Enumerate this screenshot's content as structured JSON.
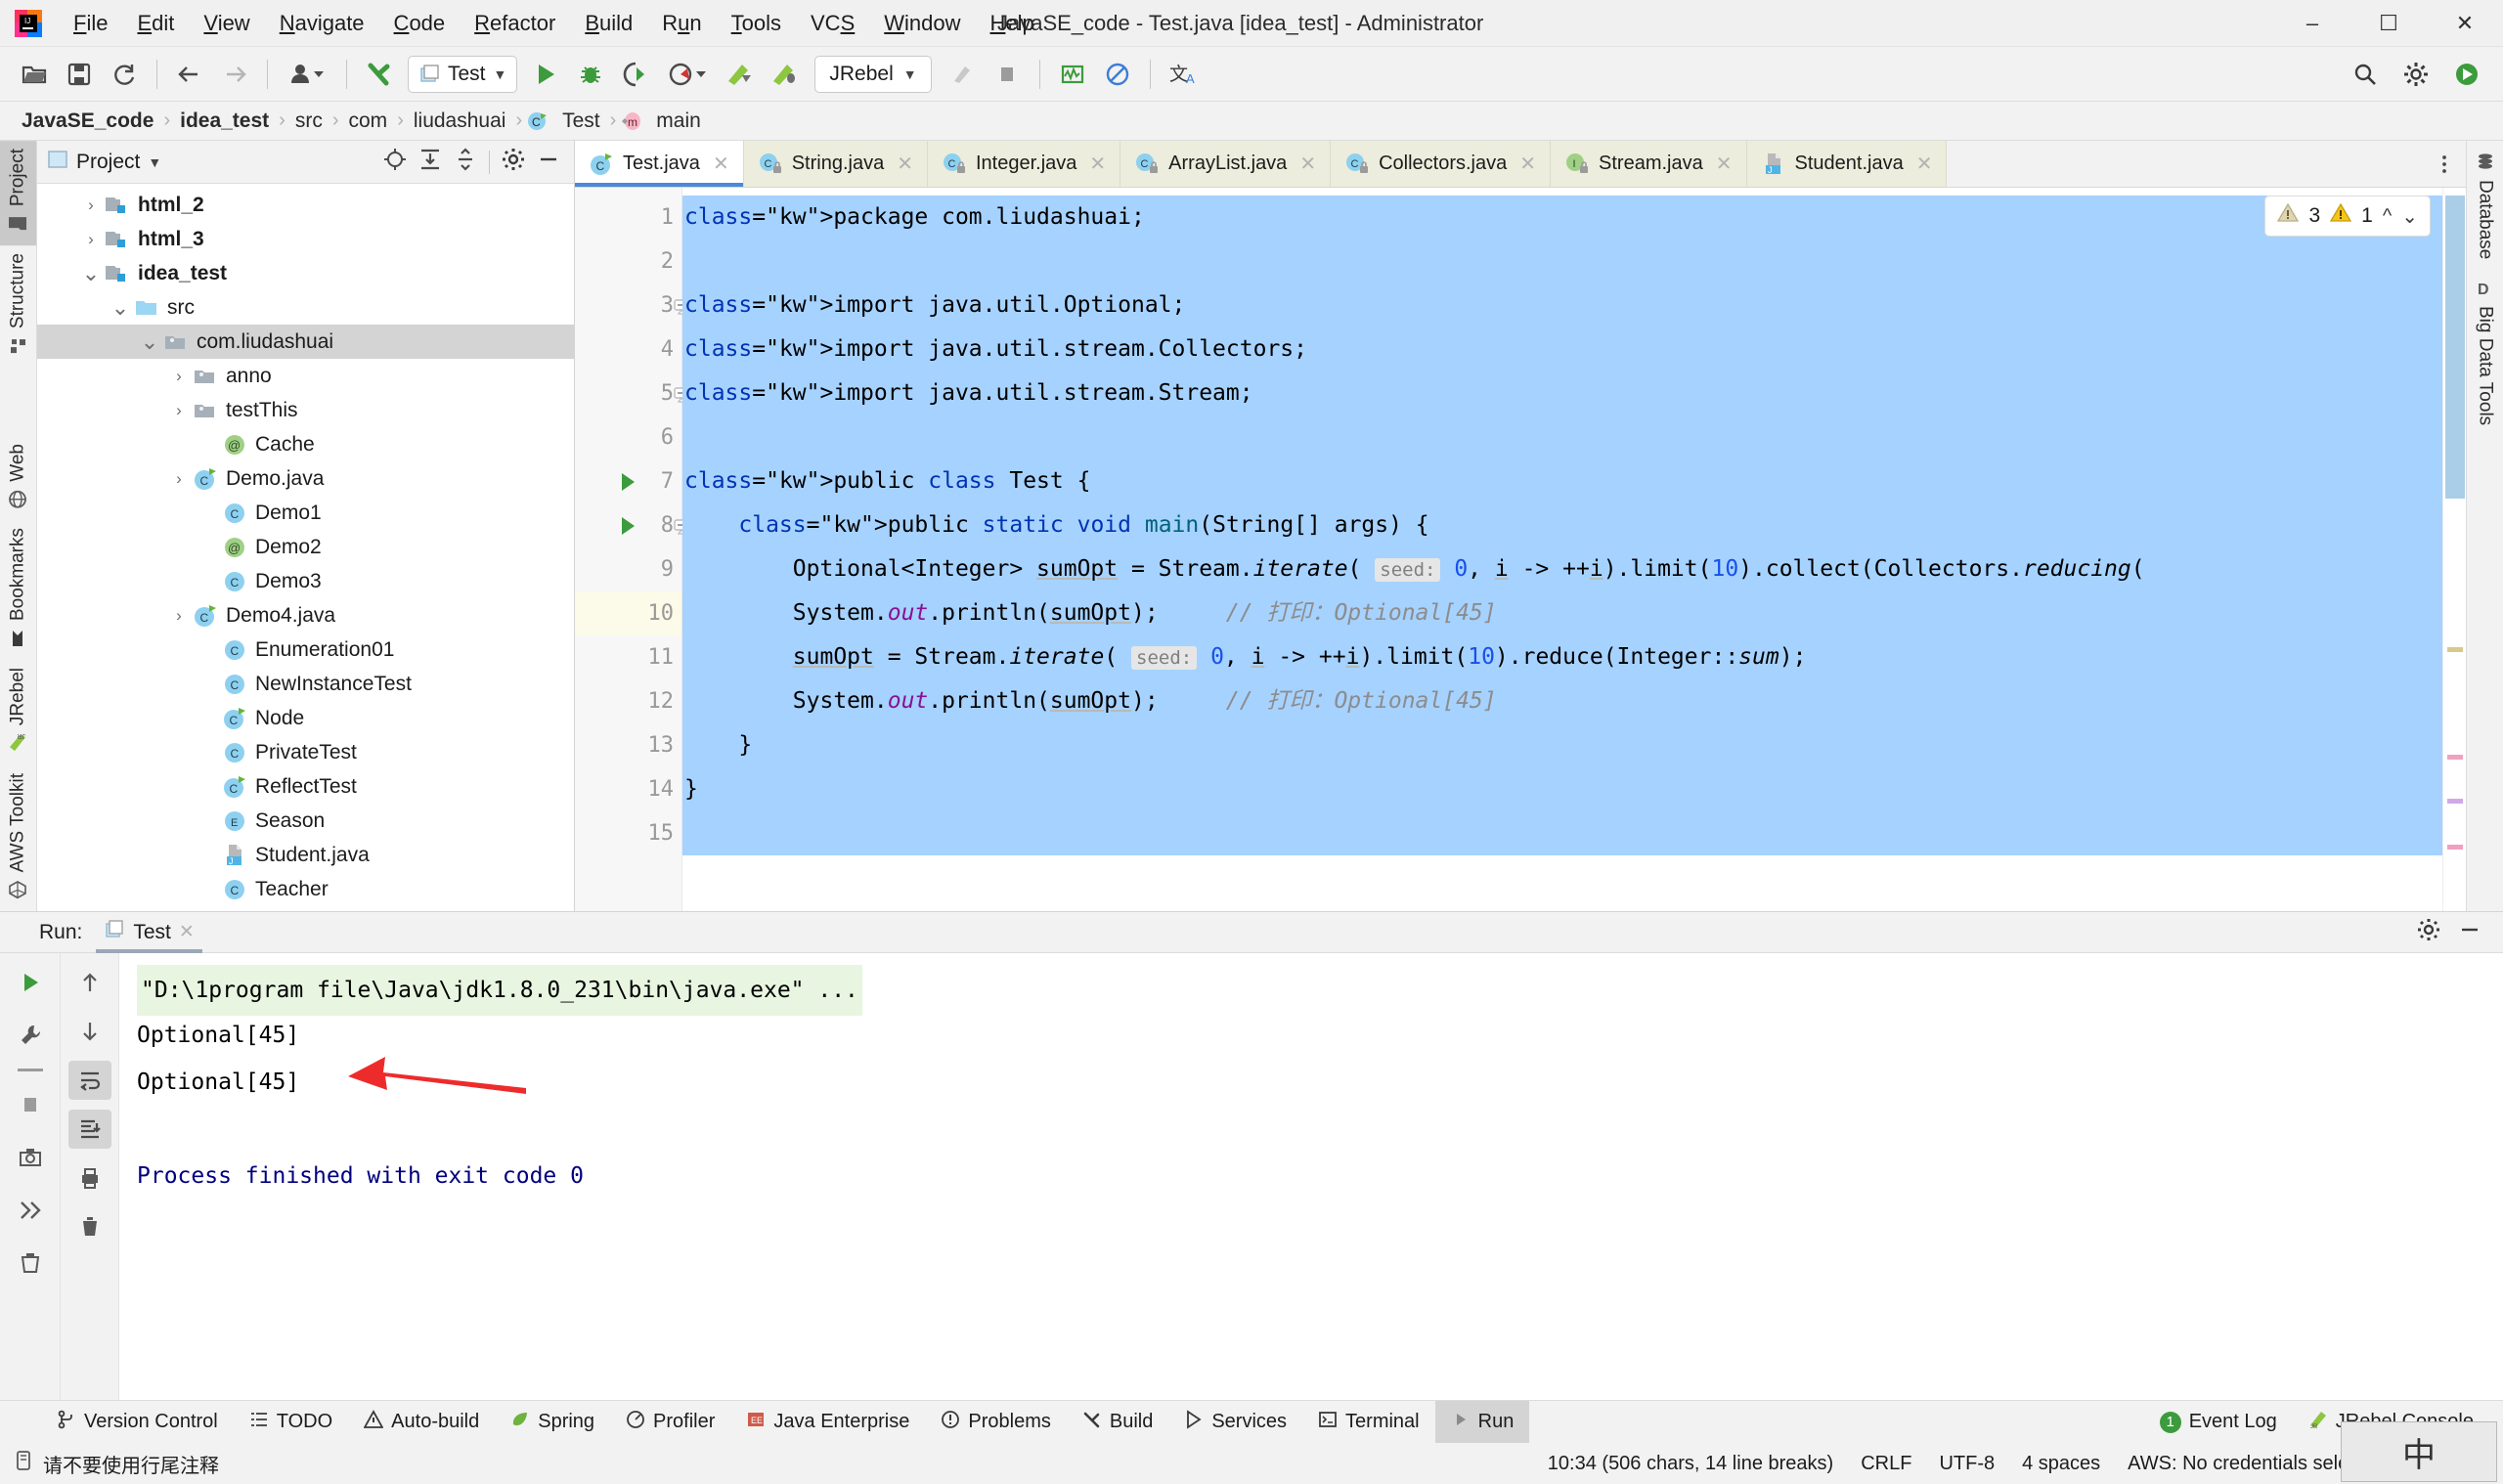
{
  "window": {
    "title": "JavaSE_code - Test.java [idea_test] - Administrator",
    "minimize": "–",
    "maximize": "❐",
    "close": "✕"
  },
  "menubar": {
    "items": [
      {
        "label": "File",
        "mnemonic": "F"
      },
      {
        "label": "Edit",
        "mnemonic": "E"
      },
      {
        "label": "View",
        "mnemonic": "V"
      },
      {
        "label": "Navigate",
        "mnemonic": "N"
      },
      {
        "label": "Code",
        "mnemonic": "C"
      },
      {
        "label": "Refactor",
        "mnemonic": "R"
      },
      {
        "label": "Build",
        "mnemonic": "B"
      },
      {
        "label": "Run",
        "mnemonic": "u"
      },
      {
        "label": "Tools",
        "mnemonic": "T"
      },
      {
        "label": "VCS",
        "mnemonic": "S"
      },
      {
        "label": "Window",
        "mnemonic": "W"
      },
      {
        "label": "Help",
        "mnemonic": "H"
      }
    ]
  },
  "toolbar": {
    "open_label": "Open",
    "save_label": "Save All",
    "sync_label": "Sync",
    "back_label": "Back",
    "forward_label": "Forward",
    "profile_label": "Profile",
    "update_label": "Update Project",
    "run_config": "Test",
    "run_label": "Run",
    "debug_label": "Debug",
    "run_coverage_label": "Run with Coverage",
    "profiler_label": "Profile",
    "jrebel_run_label": "Run with JRebel",
    "jrebel_debug_label": "Debug with JRebel",
    "jrebel_config": "JRebel",
    "stop_label": "Stop",
    "search_label": "Search Everywhere",
    "settings_label": "Settings",
    "translate_label": "Translate"
  },
  "breadcrumbs": {
    "items": [
      {
        "label": "JavaSE_code",
        "bold": true,
        "icon": ""
      },
      {
        "label": "idea_test",
        "bold": true,
        "icon": ""
      },
      {
        "label": "src",
        "bold": false,
        "icon": ""
      },
      {
        "label": "com",
        "bold": false,
        "icon": ""
      },
      {
        "label": "liudashuai",
        "bold": false,
        "icon": ""
      },
      {
        "label": "Test",
        "bold": false,
        "icon": "class-icon"
      },
      {
        "label": "main",
        "bold": false,
        "icon": "method-icon"
      }
    ],
    "separator": "›"
  },
  "left_strip": {
    "tabs": [
      {
        "label": "Project",
        "icon": "folder-icon",
        "active": true
      },
      {
        "label": "Structure",
        "icon": "structure-icon",
        "active": false
      }
    ],
    "bottom_tabs": [
      {
        "label": "Web",
        "icon": "globe-icon"
      },
      {
        "label": "Bookmarks",
        "icon": "bookmark-icon"
      },
      {
        "label": "JRebel",
        "icon": "jrebel-icon"
      },
      {
        "label": "AWS Toolkit",
        "icon": "aws-icon"
      }
    ]
  },
  "right_strip": {
    "tabs": [
      {
        "label": "Database",
        "icon": "database-icon"
      },
      {
        "label": "Big Data Tools",
        "icon": "bigdata-icon"
      }
    ]
  },
  "project_panel": {
    "title": "Project",
    "dropdown": "▼",
    "icons": [
      "locate-icon",
      "expand-all-icon",
      "collapse-all-icon",
      "gear-icon",
      "minimize-icon"
    ],
    "tree": [
      {
        "label": "html_2",
        "indent": 1,
        "twisty": "›",
        "icon": "module-folder-icon",
        "bold": true,
        "selected": false
      },
      {
        "label": "html_3",
        "indent": 1,
        "twisty": "›",
        "icon": "module-folder-icon",
        "bold": true,
        "selected": false
      },
      {
        "label": "idea_test",
        "indent": 1,
        "twisty": "⌄",
        "icon": "module-folder-icon",
        "bold": true,
        "selected": false
      },
      {
        "label": "src",
        "indent": 2,
        "twisty": "⌄",
        "icon": "source-folder-icon",
        "bold": false,
        "selected": false
      },
      {
        "label": "com.liudashuai",
        "indent": 3,
        "twisty": "⌄",
        "icon": "package-icon",
        "bold": false,
        "selected": true
      },
      {
        "label": "anno",
        "indent": 4,
        "twisty": "›",
        "icon": "package-icon",
        "bold": false,
        "selected": false
      },
      {
        "label": "testThis",
        "indent": 4,
        "twisty": "›",
        "icon": "package-icon",
        "bold": false,
        "selected": false
      },
      {
        "label": "Cache",
        "indent": 5,
        "twisty": "",
        "icon": "annotation-icon",
        "bold": false,
        "selected": false
      },
      {
        "label": "Demo.java",
        "indent": 4,
        "twisty": "›",
        "icon": "runnable-class-icon",
        "bold": false,
        "selected": false
      },
      {
        "label": "Demo1",
        "indent": 5,
        "twisty": "",
        "icon": "class-icon",
        "bold": false,
        "selected": false
      },
      {
        "label": "Demo2",
        "indent": 5,
        "twisty": "",
        "icon": "annotation-icon",
        "bold": false,
        "selected": false
      },
      {
        "label": "Demo3",
        "indent": 5,
        "twisty": "",
        "icon": "class-icon",
        "bold": false,
        "selected": false
      },
      {
        "label": "Demo4.java",
        "indent": 4,
        "twisty": "›",
        "icon": "runnable-class-icon",
        "bold": false,
        "selected": false
      },
      {
        "label": "Enumeration01",
        "indent": 5,
        "twisty": "",
        "icon": "class-icon",
        "bold": false,
        "selected": false
      },
      {
        "label": "NewInstanceTest",
        "indent": 5,
        "twisty": "",
        "icon": "class-icon",
        "bold": false,
        "selected": false
      },
      {
        "label": "Node",
        "indent": 5,
        "twisty": "",
        "icon": "runnable-class-icon",
        "bold": false,
        "selected": false
      },
      {
        "label": "PrivateTest",
        "indent": 5,
        "twisty": "",
        "icon": "class-icon",
        "bold": false,
        "selected": false
      },
      {
        "label": "ReflectTest",
        "indent": 5,
        "twisty": "",
        "icon": "runnable-class-icon",
        "bold": false,
        "selected": false
      },
      {
        "label": "Season",
        "indent": 5,
        "twisty": "",
        "icon": "enum-icon",
        "bold": false,
        "selected": false
      },
      {
        "label": "Student.java",
        "indent": 5,
        "twisty": "",
        "icon": "java-file-icon",
        "bold": false,
        "selected": false
      },
      {
        "label": "Teacher",
        "indent": 5,
        "twisty": "",
        "icon": "class-icon",
        "bold": false,
        "selected": false
      }
    ]
  },
  "editor": {
    "tabs": [
      {
        "label": "Test.java",
        "icon": "runnable-class-icon",
        "active": true
      },
      {
        "label": "String.java",
        "icon": "locked-class-icon",
        "active": false
      },
      {
        "label": "Integer.java",
        "icon": "locked-class-icon",
        "active": false
      },
      {
        "label": "ArrayList.java",
        "icon": "locked-class-icon",
        "active": false
      },
      {
        "label": "Collectors.java",
        "icon": "locked-class-icon",
        "active": false
      },
      {
        "label": "Stream.java",
        "icon": "locked-interface-icon",
        "active": false
      },
      {
        "label": "Student.java",
        "icon": "java-file-icon",
        "active": false
      }
    ],
    "tab_close": "✕",
    "more_tabs": "⋮",
    "inspection": {
      "warnings_weak": "3",
      "warnings_strong": "1",
      "up": "⌃",
      "down": "⌄"
    },
    "line_numbers": [
      "1",
      "2",
      "3",
      "4",
      "5",
      "6",
      "7",
      "8",
      "9",
      "10",
      "11",
      "12",
      "13",
      "14",
      "15"
    ],
    "current_line": 10,
    "run_gutter_lines": [
      7,
      8
    ],
    "lines": [
      {
        "n": 1,
        "text": "package com.liudashuai;"
      },
      {
        "n": 2,
        "text": ""
      },
      {
        "n": 3,
        "text": "import java.util.Optional;"
      },
      {
        "n": 4,
        "text": "import java.util.stream.Collectors;"
      },
      {
        "n": 5,
        "text": "import java.util.stream.Stream;"
      },
      {
        "n": 6,
        "text": ""
      },
      {
        "n": 7,
        "text": "public class Test {"
      },
      {
        "n": 8,
        "text": "    public static void main(String[] args) {"
      },
      {
        "n": 9,
        "text": "        Optional<Integer> sumOpt = Stream.iterate( seed: 0, i -> ++i).limit(10).collect(Collectors.reducing("
      },
      {
        "n": 10,
        "text": "        System.out.println(sumOpt);     // 打印：Optional[45]"
      },
      {
        "n": 11,
        "text": "        sumOpt = Stream.iterate( seed: 0, i -> ++i).limit(10).reduce(Integer::sum);"
      },
      {
        "n": 12,
        "text": "        System.out.println(sumOpt);     // 打印：Optional[45]"
      },
      {
        "n": 13,
        "text": "    }"
      },
      {
        "n": 14,
        "text": "}"
      },
      {
        "n": 15,
        "text": ""
      }
    ],
    "param_hint_seed": "seed:",
    "comment_text": "// 打印：Optional[45]"
  },
  "run_window": {
    "label": "Run:",
    "tab": "Test",
    "tab_close": "✕",
    "gear": "gear-icon",
    "minimize": "–",
    "sidebar_buttons": [
      "rerun-icon",
      "settings-wrench-icon",
      "stop-icon",
      "camera-icon",
      "thread-dump-icon",
      "trash-icon"
    ],
    "sidebar2_buttons": [
      "scroll-up-icon",
      "scroll-down-icon",
      "soft-wrap-icon",
      "scroll-to-end-icon",
      "print-icon",
      "clear-all-icon"
    ],
    "console": {
      "command": "\"D:\\1program file\\Java\\jdk1.8.0_231\\bin\\java.exe\" ...",
      "output": [
        "Optional[45]",
        "Optional[45]"
      ],
      "blank": "",
      "exit": "Process finished with exit code 0"
    }
  },
  "statusbar": {
    "left_items": [
      {
        "label": "Version Control",
        "icon": "branch-icon",
        "active": false
      },
      {
        "label": "TODO",
        "icon": "list-icon",
        "active": false
      },
      {
        "label": "Auto-build",
        "icon": "warning-triangle-icon",
        "active": false
      },
      {
        "label": "Spring",
        "icon": "spring-leaf-icon",
        "active": false
      },
      {
        "label": "Profiler",
        "icon": "profiler-icon",
        "active": false
      },
      {
        "label": "Java Enterprise",
        "icon": "java-enterprise-icon",
        "active": false
      },
      {
        "label": "Problems",
        "icon": "problems-icon",
        "active": false
      },
      {
        "label": "Build",
        "icon": "build-hammer-icon",
        "active": false
      },
      {
        "label": "Services",
        "icon": "services-icon",
        "active": false
      },
      {
        "label": "Terminal",
        "icon": "terminal-icon",
        "active": false
      },
      {
        "label": "Run",
        "icon": "run-play-icon",
        "active": true
      }
    ],
    "right_items": [
      {
        "label": "Event Log",
        "icon": "event-log-icon",
        "badge": "1"
      },
      {
        "label": "JRebel Console",
        "icon": "jrebel-icon",
        "badge": ""
      }
    ],
    "message": "请不要使用行尾注释",
    "message_icon": "notification-icon",
    "position": "10:34 (506 chars, 14 line breaks)",
    "line_sep": "CRLF",
    "encoding": "UTF-8",
    "indent": "4 spaces",
    "aws": "AWS: No credentials selected",
    "ime": "中"
  },
  "colors": {
    "accent_blue": "#4a89dc",
    "selection": "#a6d2ff",
    "keyword": "#0033b3",
    "number": "#1750eb",
    "comment": "#8c8c8c",
    "field": "#871094",
    "green_run": "#3c9b3c",
    "tab_bg": "#eceddc",
    "arrow_red": "#ee2b2b"
  }
}
